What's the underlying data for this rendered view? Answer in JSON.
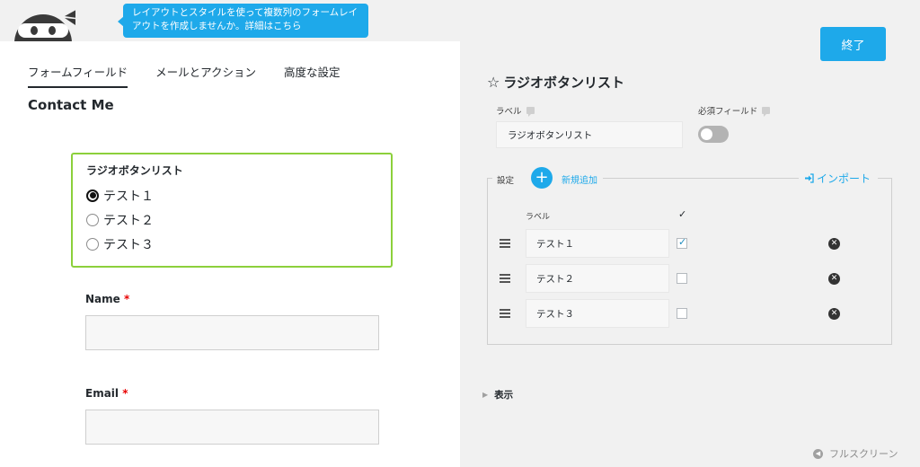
{
  "tooltip": {
    "line1": "レイアウトとスタイルを使って複数列のフォームレイ",
    "line2": "アウトを作成しませんか。詳細はこちら"
  },
  "tabs": [
    {
      "label": "フォームフィールド",
      "active": true
    },
    {
      "label": "メールとアクション",
      "active": false
    },
    {
      "label": "高度な設定",
      "active": false
    }
  ],
  "form": {
    "title": "Contact Me",
    "radio_field": {
      "label": "ラジオボタンリスト",
      "options": [
        {
          "label": "テスト１",
          "selected": true
        },
        {
          "label": "テスト２",
          "selected": false
        },
        {
          "label": "テスト３",
          "selected": false
        }
      ]
    },
    "name_field": {
      "label": "Name",
      "required_mark": "*"
    },
    "email_field": {
      "label": "Email",
      "required_mark": "*"
    }
  },
  "panel": {
    "done_label": "終了",
    "title_icon": "star-icon",
    "title": "ラジオボタンリスト",
    "label_caption": "ラベル",
    "label_value": "ラジオボタンリスト",
    "required_caption": "必須フィールド",
    "required_on": false,
    "settings_legend": "設定",
    "add_new": "新規追加",
    "import": "インポート",
    "col_label": "ラベル",
    "col_check": "✓",
    "options": [
      {
        "label": "テスト１",
        "checked": true
      },
      {
        "label": "テスト２",
        "checked": false
      },
      {
        "label": "テスト３",
        "checked": false
      }
    ],
    "display_label": "表示",
    "fullscreen_label": "フルスクリーン"
  },
  "colors": {
    "accent": "#1ea9ea",
    "selected_field_border": "#8cd03b",
    "required": "#e80000",
    "panel_bg": "#f1f1f1"
  }
}
